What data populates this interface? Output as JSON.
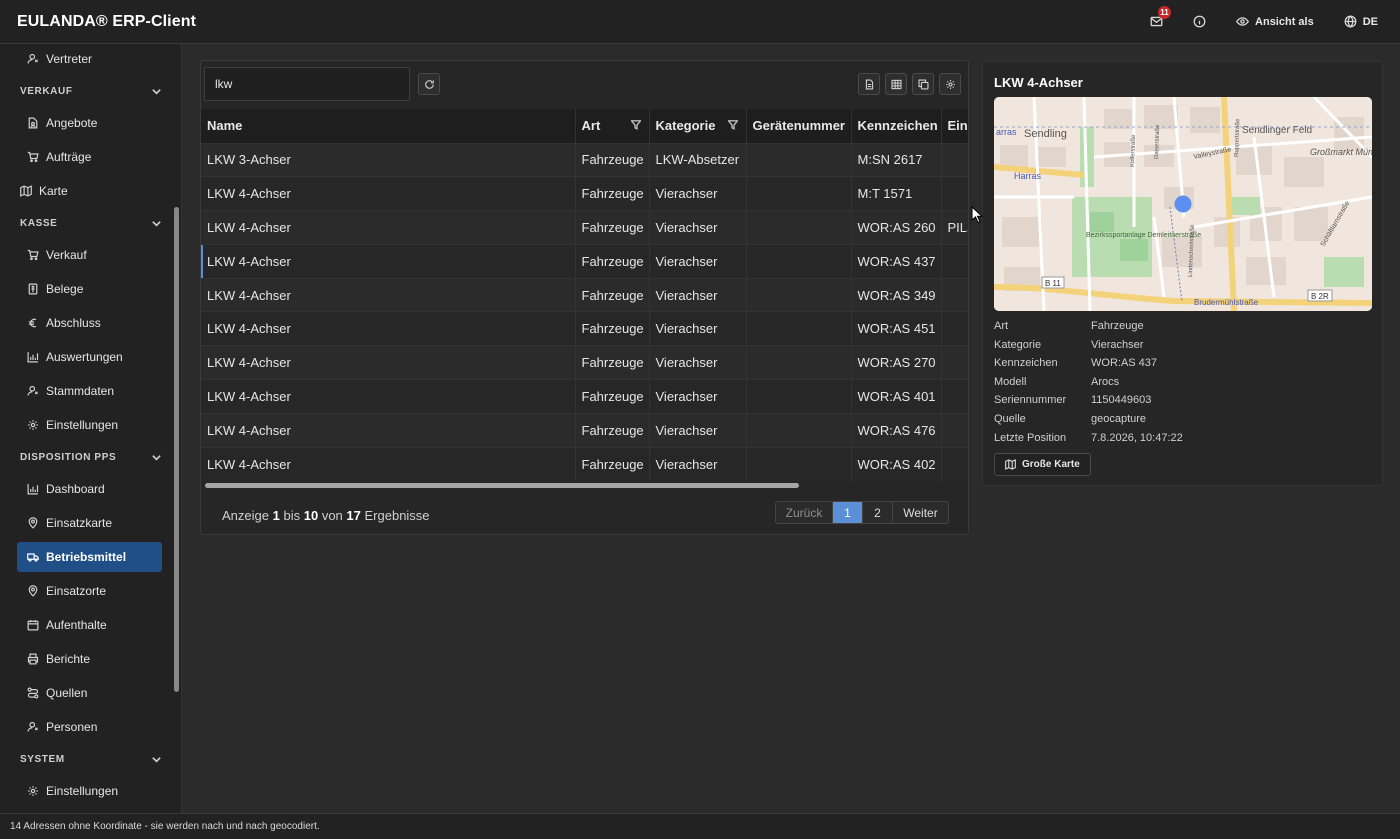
{
  "app": {
    "title": "EULANDA® ERP-Client"
  },
  "header": {
    "mail_badge": "11",
    "view_as_label": "Ansicht als",
    "language_label": "DE"
  },
  "sidebar": {
    "items_top": [
      {
        "label": "Vertreter",
        "icon": "user-icon"
      }
    ],
    "sections": [
      {
        "title": "VERKAUF",
        "items": [
          {
            "label": "Angebote",
            "icon": "document-user-icon"
          },
          {
            "label": "Aufträge",
            "icon": "cart-icon"
          }
        ]
      },
      {
        "title": "KASSE",
        "items": [
          {
            "label": "Verkauf",
            "icon": "cart-icon"
          },
          {
            "label": "Belege",
            "icon": "receipt-icon"
          },
          {
            "label": "Abschluss",
            "icon": "euro-icon"
          },
          {
            "label": "Auswertungen",
            "icon": "bar-chart-icon"
          },
          {
            "label": "Stammdaten",
            "icon": "user-icon"
          },
          {
            "label": "Einstellungen",
            "icon": "gear-icon"
          }
        ]
      },
      {
        "title": "DISPOSITION PPS",
        "items": [
          {
            "label": "Dashboard",
            "icon": "bar-chart-icon"
          },
          {
            "label": "Einsatzkarte",
            "icon": "pin-icon"
          },
          {
            "label": "Betriebsmittel",
            "icon": "truck-icon",
            "active": true
          },
          {
            "label": "Einsatzorte",
            "icon": "pin-icon"
          },
          {
            "label": "Aufenthalte",
            "icon": "calendar-icon"
          },
          {
            "label": "Berichte",
            "icon": "printer-icon"
          },
          {
            "label": "Quellen",
            "icon": "route-icon"
          },
          {
            "label": "Personen",
            "icon": "user-icon"
          }
        ]
      },
      {
        "title": "SYSTEM",
        "items": [
          {
            "label": "Einstellungen",
            "icon": "gear-icon"
          }
        ]
      }
    ],
    "karte_label": "Karte"
  },
  "grid": {
    "search_value": "lkw",
    "columns": [
      "Name",
      "Art",
      "Kategorie",
      "Gerätenummer",
      "Kennzeichen",
      "Eins"
    ],
    "rows": [
      [
        "LKW 3-Achser",
        "Fahrzeuge",
        "LKW-Absetzer",
        "",
        "M:SN 2617",
        ""
      ],
      [
        "LKW 4-Achser",
        "Fahrzeuge",
        "Vierachser",
        "",
        "M:T 1571",
        ""
      ],
      [
        "LKW 4-Achser",
        "Fahrzeuge",
        "Vierachser",
        "",
        "WOR:AS 260",
        "PILS"
      ],
      [
        "LKW 4-Achser",
        "Fahrzeuge",
        "Vierachser",
        "",
        "WOR:AS 437",
        ""
      ],
      [
        "LKW 4-Achser",
        "Fahrzeuge",
        "Vierachser",
        "",
        "WOR:AS 349",
        ""
      ],
      [
        "LKW 4-Achser",
        "Fahrzeuge",
        "Vierachser",
        "",
        "WOR:AS 451",
        ""
      ],
      [
        "LKW 4-Achser",
        "Fahrzeuge",
        "Vierachser",
        "",
        "WOR:AS 270",
        ""
      ],
      [
        "LKW 4-Achser",
        "Fahrzeuge",
        "Vierachser",
        "",
        "WOR:AS 401",
        ""
      ],
      [
        "LKW 4-Achser",
        "Fahrzeuge",
        "Vierachser",
        "",
        "WOR:AS 476",
        ""
      ],
      [
        "LKW 4-Achser",
        "Fahrzeuge",
        "Vierachser",
        "",
        "WOR:AS 402",
        ""
      ]
    ],
    "selected_row": 3,
    "pager": {
      "prefix": "Anzeige",
      "from": "1",
      "mid1": "bis",
      "to": "10",
      "mid2": "von",
      "total": "17",
      "suffix": "Ergebnisse",
      "prev_label": "Zurück",
      "pages": [
        "1",
        "2"
      ],
      "current_page": "1",
      "next_label": "Weiter"
    }
  },
  "detail": {
    "title": "LKW 4-Achser",
    "map_labels": {
      "sendling": "Sendling",
      "harras": "Harras",
      "arras": "arras",
      "sendlinger_feld": "Sendlinger Feld",
      "grossmarkthalle": "Großmarkt München",
      "valleystrasse": "Valleystraße",
      "bezirkssportanlage": "Bezirkssportanlage Demleitnerstraße",
      "brudermuehlstrasse": "Brudermühlstraße",
      "b11": "B 11",
      "b2r": "B 2R",
      "schaeftlarnstrasse": "Schäftlarnstraße",
      "kidlerstrasse": "Kidlerstraße",
      "daiserstrasse": "Daiserstraße",
      "ruppertstrasse": "Ruppertstraße",
      "lindenschmitstrasse": "Lindenschmitstraße"
    },
    "fields": [
      {
        "key": "Art",
        "value": "Fahrzeuge"
      },
      {
        "key": "Kategorie",
        "value": "Vierachser"
      },
      {
        "key": "Kennzeichen",
        "value": "WOR:AS 437"
      },
      {
        "key": "Modell",
        "value": "Arocs"
      },
      {
        "key": "Seriennummer",
        "value": "1150449603"
      },
      {
        "key": "Quelle",
        "value": "geocapture"
      },
      {
        "key": "Letzte Position",
        "value": "7.8.2026, 10:47:22"
      }
    ],
    "big_map_label": "Große Karte"
  },
  "statusbar": {
    "text": "14 Adressen ohne Koordinate - sie werden nach und nach geocodiert."
  },
  "colors": {
    "accent": "#1f4f86",
    "page_current": "#5b8fd6",
    "badge": "#c62828",
    "map_marker": "#5b8ff0"
  }
}
